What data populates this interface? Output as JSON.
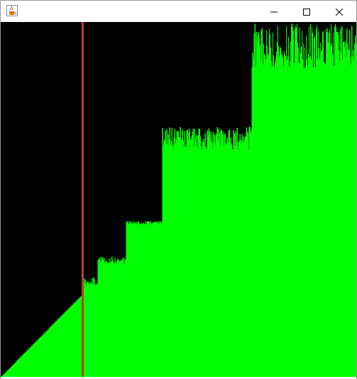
{
  "window": {
    "title": "",
    "app_icon": "java-coffee-cup-icon",
    "controls": {
      "minimize_icon": "minimize-icon",
      "maximize_icon": "maximize-icon",
      "close_icon": "close-icon"
    }
  },
  "visualization": {
    "background_color": "#000000",
    "bar_color": "#00ff00",
    "marker_color": "#c0392b",
    "value_count": 500,
    "marker_index": 114,
    "levels": [
      {
        "from_index": 0,
        "to_index": 114,
        "kind": "sorted-ramp"
      },
      {
        "from_index": 114,
        "to_index": 136,
        "base": 0.26,
        "peak": 0.28
      },
      {
        "from_index": 136,
        "to_index": 176,
        "base": 0.32,
        "peak": 0.34
      },
      {
        "from_index": 176,
        "to_index": 227,
        "base": 0.43,
        "peak": 0.44
      },
      {
        "from_index": 227,
        "to_index": 353,
        "base": 0.64,
        "peak": 0.7
      },
      {
        "from_index": 353,
        "to_index": 500,
        "base": 0.87,
        "peak": 0.99
      }
    ]
  }
}
